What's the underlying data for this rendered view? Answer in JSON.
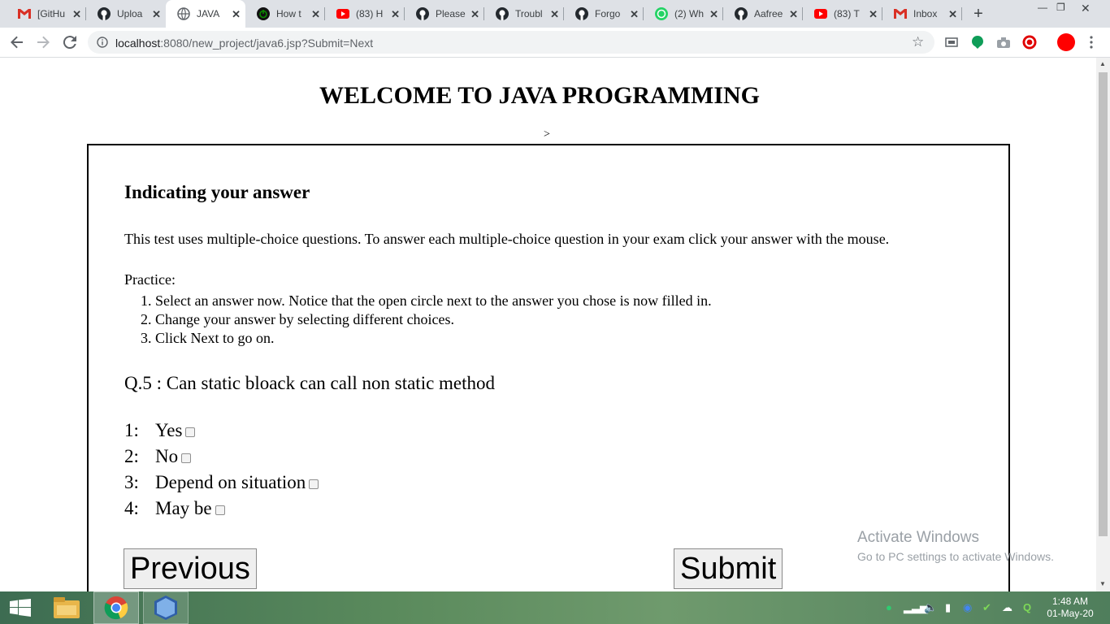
{
  "browser": {
    "tabs": [
      {
        "label": "[GitHu",
        "icon": "gmail-icon",
        "icon_color": "#d93025"
      },
      {
        "label": "Uploa",
        "icon": "github-icon",
        "icon_color": "#24292e"
      },
      {
        "label": "JAVA",
        "icon": "globe-icon",
        "icon_color": "#5f6368",
        "active": true
      },
      {
        "label": "How t",
        "icon": "power-icon",
        "icon_color": "#0b8a00"
      },
      {
        "label": "(83) H",
        "icon": "youtube-icon",
        "icon_color": "#ff0000"
      },
      {
        "label": "Please",
        "icon": "github-icon",
        "icon_color": "#24292e"
      },
      {
        "label": "Troubl",
        "icon": "github-icon",
        "icon_color": "#24292e"
      },
      {
        "label": "Forgo",
        "icon": "github-icon",
        "icon_color": "#24292e"
      },
      {
        "label": "(2) Wh",
        "icon": "whatsapp-icon",
        "icon_color": "#25d366"
      },
      {
        "label": "Aafree",
        "icon": "github-icon",
        "icon_color": "#24292e"
      },
      {
        "label": "(83) T",
        "icon": "youtube-icon",
        "icon_color": "#ff0000"
      },
      {
        "label": "Inbox",
        "icon": "gmail-icon",
        "icon_color": "#d93025"
      }
    ],
    "url_host": "localhost",
    "url_rest": ":8080/new_project/java6.jsp?Submit=Next"
  },
  "page": {
    "title": "WELCOME TO JAVA PROGRAMMING",
    "stray_text": ">",
    "instructions_heading": "Indicating your answer",
    "instructions_text": "This test uses multiple-choice questions. To answer each multiple-choice question in your exam click your answer with the mouse.",
    "practice_label": "Practice:",
    "practice_steps": [
      "1. Select an answer now. Notice that the open circle next to the answer you chose is now filled in.",
      "2. Change your answer by selecting different choices.",
      "3. Click Next to go on."
    ],
    "question": "Q.5 : Can static bloack can call non static method",
    "options": [
      {
        "num": "1:",
        "label": "Yes",
        "checked": false
      },
      {
        "num": "2:",
        "label": "No",
        "checked": false
      },
      {
        "num": "3:",
        "label": "Depend on situation",
        "checked": false
      },
      {
        "num": "4:",
        "label": "May be",
        "checked": false
      }
    ],
    "previous_label": "Previous",
    "submit_label": "Submit"
  },
  "watermark": {
    "line1": "Activate Windows",
    "line2": "Go to PC settings to activate Windows."
  },
  "taskbar": {
    "time": "1:48 AM",
    "date": "01-May-20"
  }
}
